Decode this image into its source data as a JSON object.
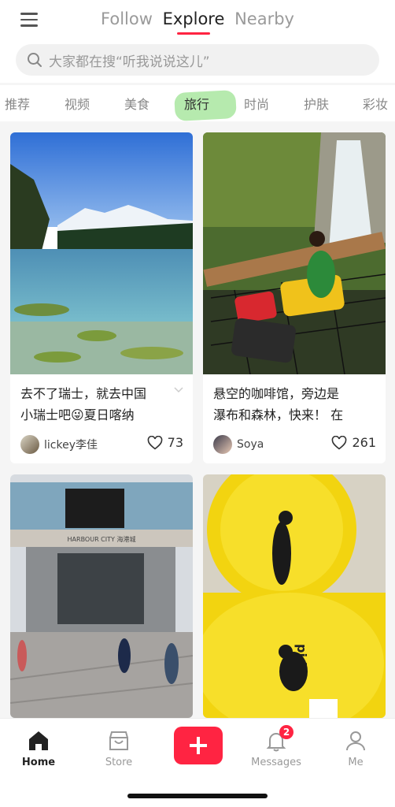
{
  "header": {
    "tabs": [
      {
        "label": "Follow",
        "active": false
      },
      {
        "label": "Explore",
        "active": true
      },
      {
        "label": "Nearby",
        "active": false
      }
    ],
    "search_placeholder": "大家都在搜“听我说说这儿”"
  },
  "categories": {
    "items": [
      "推荐",
      "视频",
      "美食",
      "旅行",
      "时尚",
      "护肤",
      "彩妆"
    ],
    "selected": "旅行",
    "highlight_color": "#a9e6a0"
  },
  "feed": {
    "cards": [
      {
        "title_line1": "去不了瑞士，就去中国",
        "title_line2": "小瑞士吧😜夏日喀纳",
        "author": "lickey李佳",
        "likes": "73",
        "image": "lake-landscape"
      },
      {
        "title_line1": "悬空的咖啡馆，旁边是",
        "title_line2": "瀑布和森林，快来！ 在",
        "author": "Soya",
        "likes": "261",
        "image": "waterfall-cafe"
      },
      {
        "title_line1": "",
        "title_line2": "",
        "author": "",
        "likes": "",
        "image": "harbour-city-mall",
        "sign_text": "HARBOUR CITY 海港城"
      },
      {
        "title_line1": "",
        "title_line2": "",
        "author": "",
        "likes": "",
        "image": "yellow-installation",
        "sign_text": "pidan"
      }
    ]
  },
  "bottom_nav": {
    "items": [
      {
        "label": "Home",
        "icon": "home-icon",
        "active": true
      },
      {
        "label": "Store",
        "icon": "store-icon",
        "active": false
      },
      {
        "label": "Messages",
        "icon": "bell-icon",
        "active": false,
        "badge": "2"
      },
      {
        "label": "Me",
        "icon": "person-icon",
        "active": false
      }
    ],
    "plus_icon": "plus-icon"
  },
  "colors": {
    "accent": "#ff2442",
    "text": "#222222",
    "muted": "#999999"
  }
}
